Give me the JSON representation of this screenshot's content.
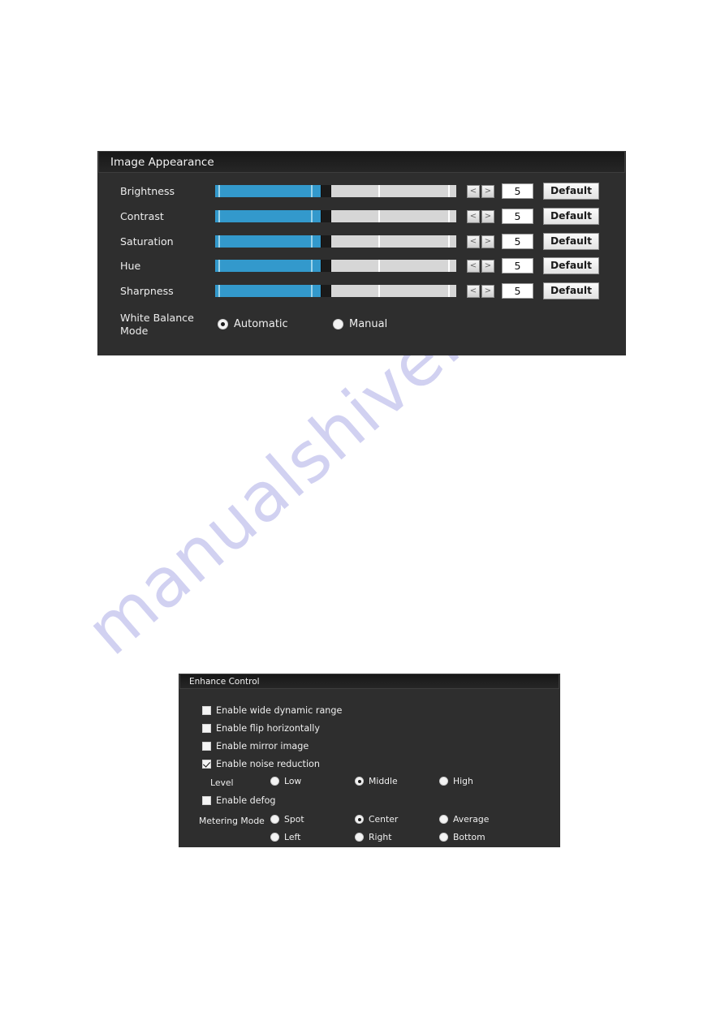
{
  "watermark": {
    "text": "manualshive.com"
  },
  "image_appearance": {
    "title": "Image Appearance",
    "sliders": [
      {
        "label": "Brightness",
        "value": "5",
        "default_label": "Default",
        "dec_icon": "<",
        "inc_icon": ">",
        "fill_percent": 44
      },
      {
        "label": "Contrast",
        "value": "5",
        "default_label": "Default",
        "dec_icon": "<",
        "inc_icon": ">",
        "fill_percent": 44
      },
      {
        "label": "Saturation",
        "value": "5",
        "default_label": "Default",
        "dec_icon": "<",
        "inc_icon": ">",
        "fill_percent": 44
      },
      {
        "label": "Hue",
        "value": "5",
        "default_label": "Default",
        "dec_icon": "<",
        "inc_icon": ">",
        "fill_percent": 44
      },
      {
        "label": "Sharpness",
        "value": "5",
        "default_label": "Default",
        "dec_icon": "<",
        "inc_icon": ">",
        "fill_percent": 44
      }
    ],
    "white_balance": {
      "label": "White Balance Mode",
      "options": [
        {
          "label": "Automatic",
          "selected": true
        },
        {
          "label": "Manual",
          "selected": false
        }
      ]
    }
  },
  "enhance_control": {
    "title": "Enhance Control",
    "checkboxes": [
      {
        "label": "Enable wide dynamic range",
        "checked": false
      },
      {
        "label": "Enable flip horizontally",
        "checked": false
      },
      {
        "label": "Enable mirror image",
        "checked": false
      },
      {
        "label": "Enable noise reduction",
        "checked": true
      },
      {
        "label": "Enable defog",
        "checked": false
      }
    ],
    "level": {
      "label": "Level",
      "options": [
        {
          "label": "Low",
          "selected": false
        },
        {
          "label": "Middle",
          "selected": true
        },
        {
          "label": "High",
          "selected": false
        }
      ]
    },
    "metering_mode": {
      "label": "Metering Mode",
      "options": [
        {
          "label": "Spot",
          "selected": false
        },
        {
          "label": "Center",
          "selected": true
        },
        {
          "label": "Average",
          "selected": false
        },
        {
          "label": "Left",
          "selected": false
        },
        {
          "label": "Right",
          "selected": false
        },
        {
          "label": "Bottom",
          "selected": false
        }
      ]
    }
  },
  "colors": {
    "panel_bg": "#2e2e2e",
    "slider_fill": "#3399cc",
    "slider_track": "#d6d6d6",
    "title_text": "#f2f2f2",
    "watermark": "#c9c9ef"
  }
}
